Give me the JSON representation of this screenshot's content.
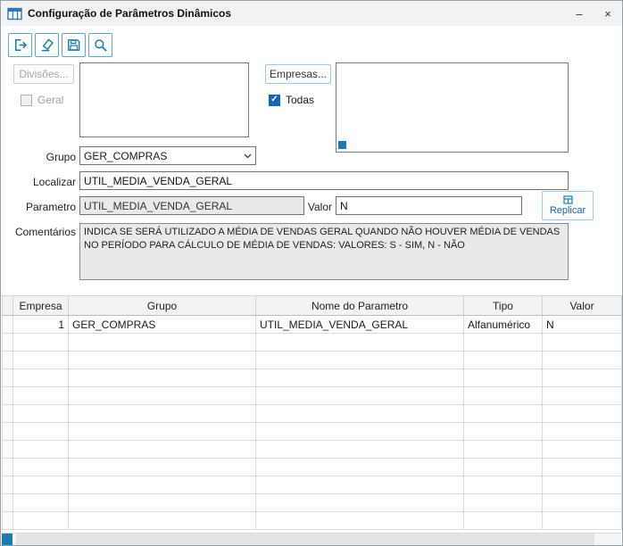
{
  "window": {
    "title": "Configuração de Parâmetros Dinâmicos",
    "minimize_glyph": "–",
    "close_glyph": "×"
  },
  "toolbar": {
    "buttons": [
      "exit",
      "clear",
      "save",
      "search"
    ]
  },
  "filters": {
    "divisoes_button": "Divisões...",
    "geral_checkbox": "Geral",
    "empresas_button": "Empresas...",
    "todas_checkbox": "Todas",
    "todas_checked_glyph": "✓"
  },
  "form": {
    "grupo_label": "Grupo",
    "grupo_value": "GER_COMPRAS",
    "localizar_label": "Localizar",
    "localizar_value": "UTIL_MEDIA_VENDA_GERAL",
    "parametro_label": "Parametro",
    "parametro_value": "UTIL_MEDIA_VENDA_GERAL",
    "valor_label": "Valor",
    "valor_value": "N",
    "replicar_button": "Replicar",
    "comentarios_label": "Comentários",
    "comentarios_value": "INDICA SE SERÁ UTILIZADO A MÉDIA DE VENDAS GERAL QUANDO NÃO HOUVER MÉDIA DE VENDAS NO PERÍODO PARA CÁLCULO DE MÉDIA DE VENDAS: VALORES: S - SIM, N - NÃO"
  },
  "grid": {
    "headers": [
      "",
      "Empresa",
      "Grupo",
      "Nome do Parametro",
      "Tipo",
      "Valor"
    ],
    "rows": [
      [
        "1",
        "GER_COMPRAS",
        "UTIL_MEDIA_VENDA_GERAL",
        "Alfanumérico",
        "N"
      ]
    ],
    "empty_row_count": 11
  },
  "colors": {
    "accent": "#1b7ab3",
    "checkbox_checked": "#1565c0",
    "titlebar_bg": "#f2f2f2"
  }
}
